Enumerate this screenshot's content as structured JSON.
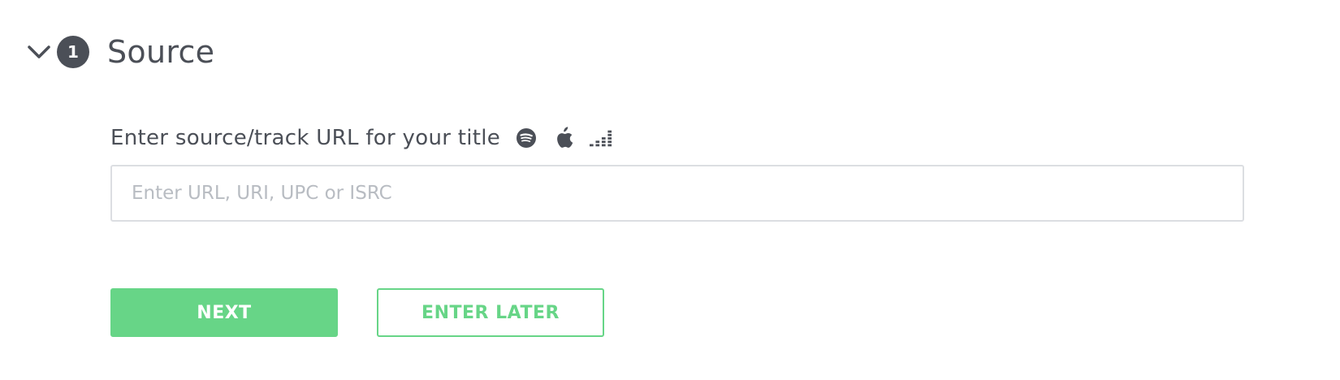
{
  "section": {
    "step_number": "1",
    "title": "Source",
    "toggle_icon": "chevron-down-icon"
  },
  "source_field": {
    "label": "Enter source/track URL for your title",
    "placeholder": "Enter URL, URI, UPC or ISRC",
    "value": "",
    "service_icons": [
      "spotify-icon",
      "apple-music-icon",
      "deezer-icon"
    ]
  },
  "actions": {
    "next_label": "NEXT",
    "enter_later_label": "ENTER LATER"
  },
  "colors": {
    "accent_green": "#67d587",
    "text_dark": "#4b4f57",
    "placeholder": "#b8bcc2",
    "border": "#dcdee2"
  }
}
